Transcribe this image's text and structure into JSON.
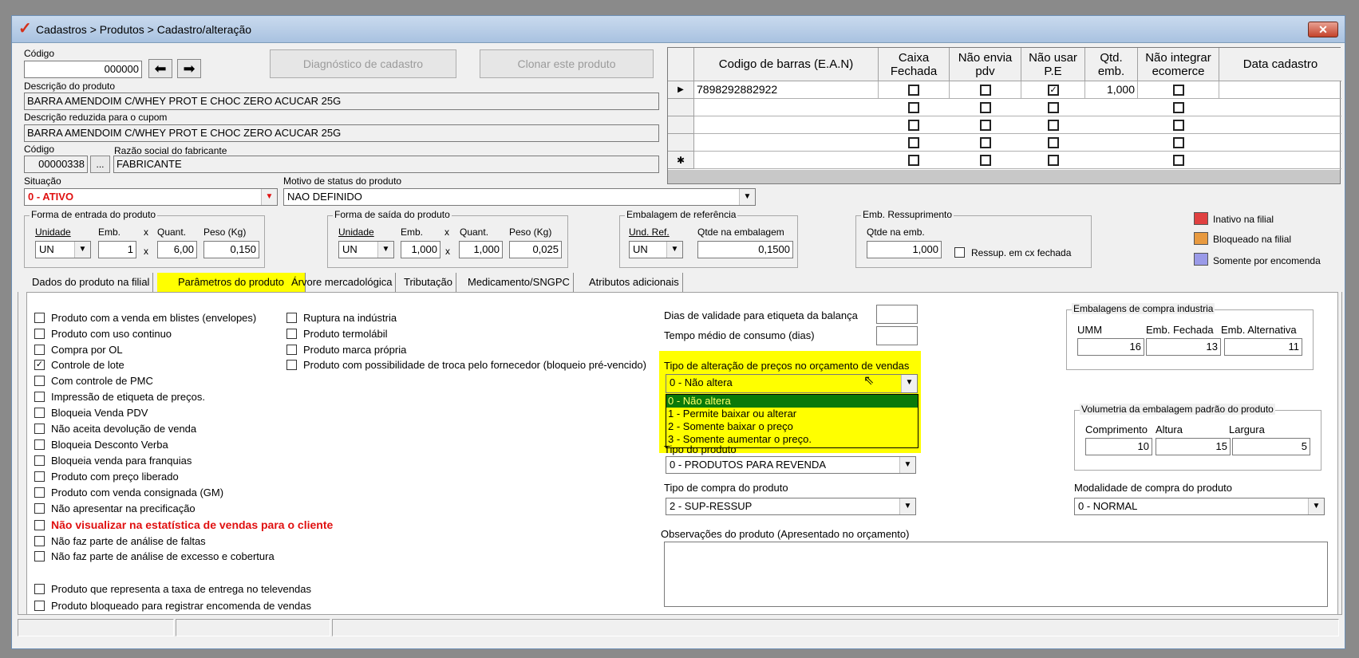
{
  "window": {
    "title": "Cadastros > Produtos > Cadastro/alteração",
    "close": "✕"
  },
  "header": {
    "codigo_label": "Código",
    "codigo_value": "000000",
    "btn_diagnostico": "Diagnóstico de cadastro",
    "btn_clonar": "Clonar este produto",
    "descricao_label": "Descrição  do produto",
    "descricao_value": "BARRA AMENDOIM C/WHEY PROT E CHOC ZERO ACUCAR 25G",
    "desc_reduzida_label": "Descrição reduzida para o cupom",
    "desc_reduzida_value": "BARRA AMENDOIM C/WHEY PROT E CHOC ZERO ACUCAR 25G",
    "fab_codigo_label": "Código",
    "fab_codigo_value": "00000338",
    "fab_razao_label": "Razão social do fabricante",
    "fab_razao_value": "FABRICANTE",
    "fab_btn": "...",
    "situacao_label": "Situação",
    "situacao_value": "0 - ATIVO",
    "motivo_label": "Motivo de status do produto",
    "motivo_value": "NAO DEFINIDO"
  },
  "entrada": {
    "title": "Forma de entrada do produto",
    "unidade_label": "Unidade",
    "emb_label": "Emb.",
    "x": "x",
    "quant_label": "Quant.",
    "peso_label": "Peso (Kg)",
    "unidade": "UN",
    "emb": "1",
    "quant": "6,00",
    "peso": "0,150"
  },
  "saida": {
    "title": "Forma de saída do produto",
    "unidade_label": "Unidade",
    "emb_label": "Emb.",
    "x": "x",
    "quant_label": "Quant.",
    "peso_label": "Peso (Kg)",
    "unidade": "UN",
    "emb": "1,000",
    "quant": "1,000",
    "peso": "0,025"
  },
  "embref": {
    "title": "Embalagem de referência",
    "und_label": "Und. Ref.",
    "qtde_label": "Qtde na embalagem",
    "und": "UN",
    "qtde": "0,1500"
  },
  "embress": {
    "title": "Emb. Ressuprimento",
    "qtde_label": "Qtde na emb.",
    "qtde": "1,000",
    "chk_label": "Ressup. em cx fechada"
  },
  "legend": [
    {
      "label": "Inativo na filial",
      "color": "#e04040"
    },
    {
      "label": "Bloqueado na filial",
      "color": "#e89a40"
    },
    {
      "label": "Somente por encomenda",
      "color": "#9a9ae8"
    }
  ],
  "grid": {
    "headers": [
      "Codigo de barras (E.A.N)",
      "Caixa Fechada",
      "Não envia pdv",
      "Não usar P.E",
      "Qtd. emb.",
      "Não integrar ecomerce",
      "Data cadastro"
    ],
    "rows": [
      {
        "ean": "7898292882922",
        "qtd": "1,000",
        "nao_usar_pe": true
      }
    ]
  },
  "tabs": [
    "Dados do produto na filial",
    "Parâmetros do produto",
    "Árvore mercadológica",
    "Tributação",
    "Medicamento/SNGPC",
    "Atributos adicionais"
  ],
  "checks_col1": [
    {
      "label": "Produto com a venda em blistes (envelopes)",
      "checked": false
    },
    {
      "label": "Produto com uso continuo",
      "checked": false
    },
    {
      "label": "Compra por OL",
      "checked": false
    },
    {
      "label": "Controle de lote",
      "checked": true
    },
    {
      "label": "Com controle de PMC",
      "checked": false
    },
    {
      "label": "Impressão de etiqueta de preços.",
      "checked": false
    },
    {
      "label": "Bloqueia Venda PDV",
      "checked": false
    },
    {
      "label": "Não aceita devolução de venda",
      "checked": false
    },
    {
      "label": "Bloqueia Desconto Verba",
      "checked": false
    },
    {
      "label": "Bloqueia venda para franquias",
      "checked": false
    },
    {
      "label": "Produto com preço liberado",
      "checked": false
    },
    {
      "label": "Produto com venda consignada (GM)",
      "checked": false
    },
    {
      "label": "Não apresentar na precificação",
      "checked": false
    },
    {
      "label": "Não visualizar na estatística de vendas para o cliente",
      "checked": false
    },
    {
      "label": "Não faz parte de análise de faltas",
      "checked": false
    },
    {
      "label": "Não faz parte de análise de excesso e cobertura",
      "checked": false
    },
    {
      "label": "Produto que representa a taxa de entrega no televendas",
      "checked": false
    },
    {
      "label": "Produto bloqueado para registrar encomenda de vendas",
      "checked": false
    }
  ],
  "checks_col2": [
    {
      "label": "Ruptura na indústria",
      "checked": false
    },
    {
      "label": "Produto termolábil",
      "checked": false
    },
    {
      "label": "Produto marca própria",
      "checked": false
    },
    {
      "label": "Produto com possibilidade de troca pelo fornecedor (bloqueio pré-vencido)",
      "checked": false
    }
  ],
  "middle": {
    "dias_label": "Dias de validade para etiqueta da balança",
    "tempo_label": "Tempo médio de consumo (dias)",
    "tipo_alt_label": "Tipo de alteração de preços no orçamento de vendas",
    "tipo_alt_value": "0 - Não altera",
    "tipo_alt_options": [
      "0 - Não altera",
      "1 - Permite baixar ou alterar",
      "2 - Somente baixar o preço",
      "3 - Somente aumentar o preço."
    ],
    "tipo_prod_label": "Tipo do produto",
    "tipo_prod_value": "0 - PRODUTOS PARA REVENDA",
    "tipo_compra_label": "Tipo de compra do produto",
    "tipo_compra_value": "2 - SUP-RESSUP",
    "obs_label": "Observações do produto (Apresentado no orçamento)"
  },
  "embcompra": {
    "title": "Embalagens de compra industria",
    "umm_label": "UMM",
    "fech_label": "Emb. Fechada",
    "alt_label": "Emb. Alternativa",
    "umm": "16",
    "fech": "13",
    "alt": "11"
  },
  "volumetria": {
    "title": "Volumetria da embalagem padrão do produto",
    "comp_label": "Comprimento",
    "alt_label": "Altura",
    "larg_label": "Largura",
    "comp": "10",
    "alt": "15",
    "larg": "5"
  },
  "modalidade": {
    "label": "Modalidade de compra do produto",
    "value": "0 - NORMAL"
  }
}
